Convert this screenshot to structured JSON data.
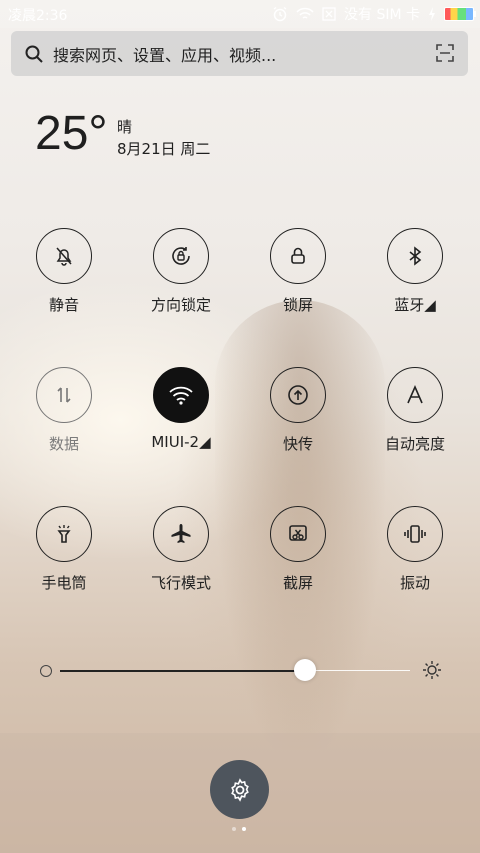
{
  "status_bar": {
    "time": "凌晨2:36",
    "no_sim": "没有 SIM 卡"
  },
  "search": {
    "placeholder": "搜索网页、设置、应用、视频..."
  },
  "weather": {
    "temperature": "25°",
    "condition": "晴",
    "date": "8月21日 周二"
  },
  "toggles": [
    {
      "label": "静音",
      "icon": "bell-off-icon"
    },
    {
      "label": "方向锁定",
      "icon": "rotation-lock-icon"
    },
    {
      "label": "锁屏",
      "icon": "lock-icon"
    },
    {
      "label": "蓝牙◢",
      "icon": "bluetooth-icon"
    },
    {
      "label": "数据",
      "icon": "mobile-data-icon",
      "state": "disabled"
    },
    {
      "label": "MIUI-2◢",
      "icon": "wifi-icon",
      "state": "active"
    },
    {
      "label": "快传",
      "icon": "share-transfer-icon"
    },
    {
      "label": "自动亮度",
      "icon": "auto-brightness-icon"
    },
    {
      "label": "手电筒",
      "icon": "flashlight-icon"
    },
    {
      "label": "飞行模式",
      "icon": "airplane-icon"
    },
    {
      "label": "截屏",
      "icon": "screenshot-icon"
    },
    {
      "label": "振动",
      "icon": "vibrate-icon"
    }
  ],
  "brightness": {
    "level": 0.7
  },
  "colors": {
    "active": "#111111",
    "settings_button": "#4e555d"
  },
  "page_indicator": {
    "count": 2,
    "active": 2
  }
}
